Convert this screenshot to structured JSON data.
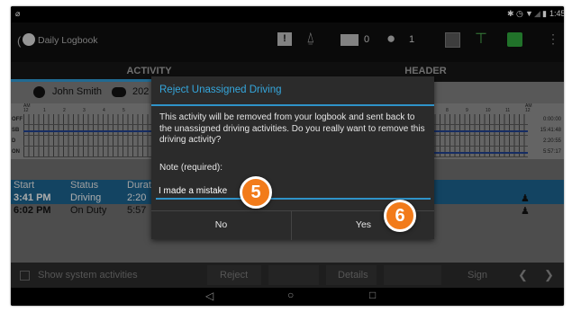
{
  "status_bar": {
    "time": "1:45",
    "icons": [
      "bluetooth-icon",
      "alarm-icon",
      "wifi-icon",
      "signal-icon",
      "battery-icon"
    ]
  },
  "app_bar": {
    "title": "Daily Logbook",
    "messages_count": "0",
    "drivers_count": "1",
    "icons": [
      "app-logo-icon",
      "alert-icon",
      "inspection-icon",
      "mail-icon",
      "person-icon",
      "fuel-icon",
      "trailer-icon",
      "truck-icon",
      "overflow-menu-icon"
    ]
  },
  "tabs": [
    {
      "label": "ACTIVITY",
      "selected": true
    },
    {
      "label": "HEADER",
      "selected": false
    }
  ],
  "driver": {
    "name": "John Smith",
    "date_partial": "202"
  },
  "graph": {
    "rows": [
      "OFF",
      "SB",
      "D",
      "ON"
    ],
    "hour_labels_left": [
      "AM",
      "12",
      "1",
      "2",
      "3",
      "4",
      "5"
    ],
    "hour_labels_right": [
      "8",
      "9",
      "10",
      "11",
      "AM",
      "12"
    ],
    "totals": [
      "0:00:00",
      "15:41:48",
      "2:20:55",
      "5:57:17"
    ]
  },
  "table": {
    "headers": [
      "Start",
      "Status",
      "Durat"
    ],
    "rows": [
      {
        "start": "3:41 PM",
        "status": "Driving",
        "duration": "2:20",
        "highlight": true
      },
      {
        "start": "6:02 PM",
        "status": "On Duty",
        "duration": "5:57",
        "highlight": false
      }
    ]
  },
  "bottom_bar": {
    "checkbox_label": "Show system activities",
    "reject": "Reject",
    "details": "Details",
    "sign": "Sign",
    "prev": "❮",
    "next": "❯"
  },
  "nav_bar": {
    "back": "◁",
    "home": "○",
    "recents": "□"
  },
  "dialog": {
    "title": "Reject Unassigned Driving",
    "message": "This activity will be removed from your logbook and sent back to the unassigned driving activities. Do you really want to remove this driving activity?",
    "note_label": "Note (required):",
    "note_value": "I made a mistake",
    "no": "No",
    "yes": "Yes"
  },
  "callouts": [
    "5",
    "6"
  ],
  "colors": {
    "accent": "#2f93c9",
    "title_blue": "#35a7dd",
    "callout": "#f27b1a",
    "selected_row": "#1b5f88"
  }
}
